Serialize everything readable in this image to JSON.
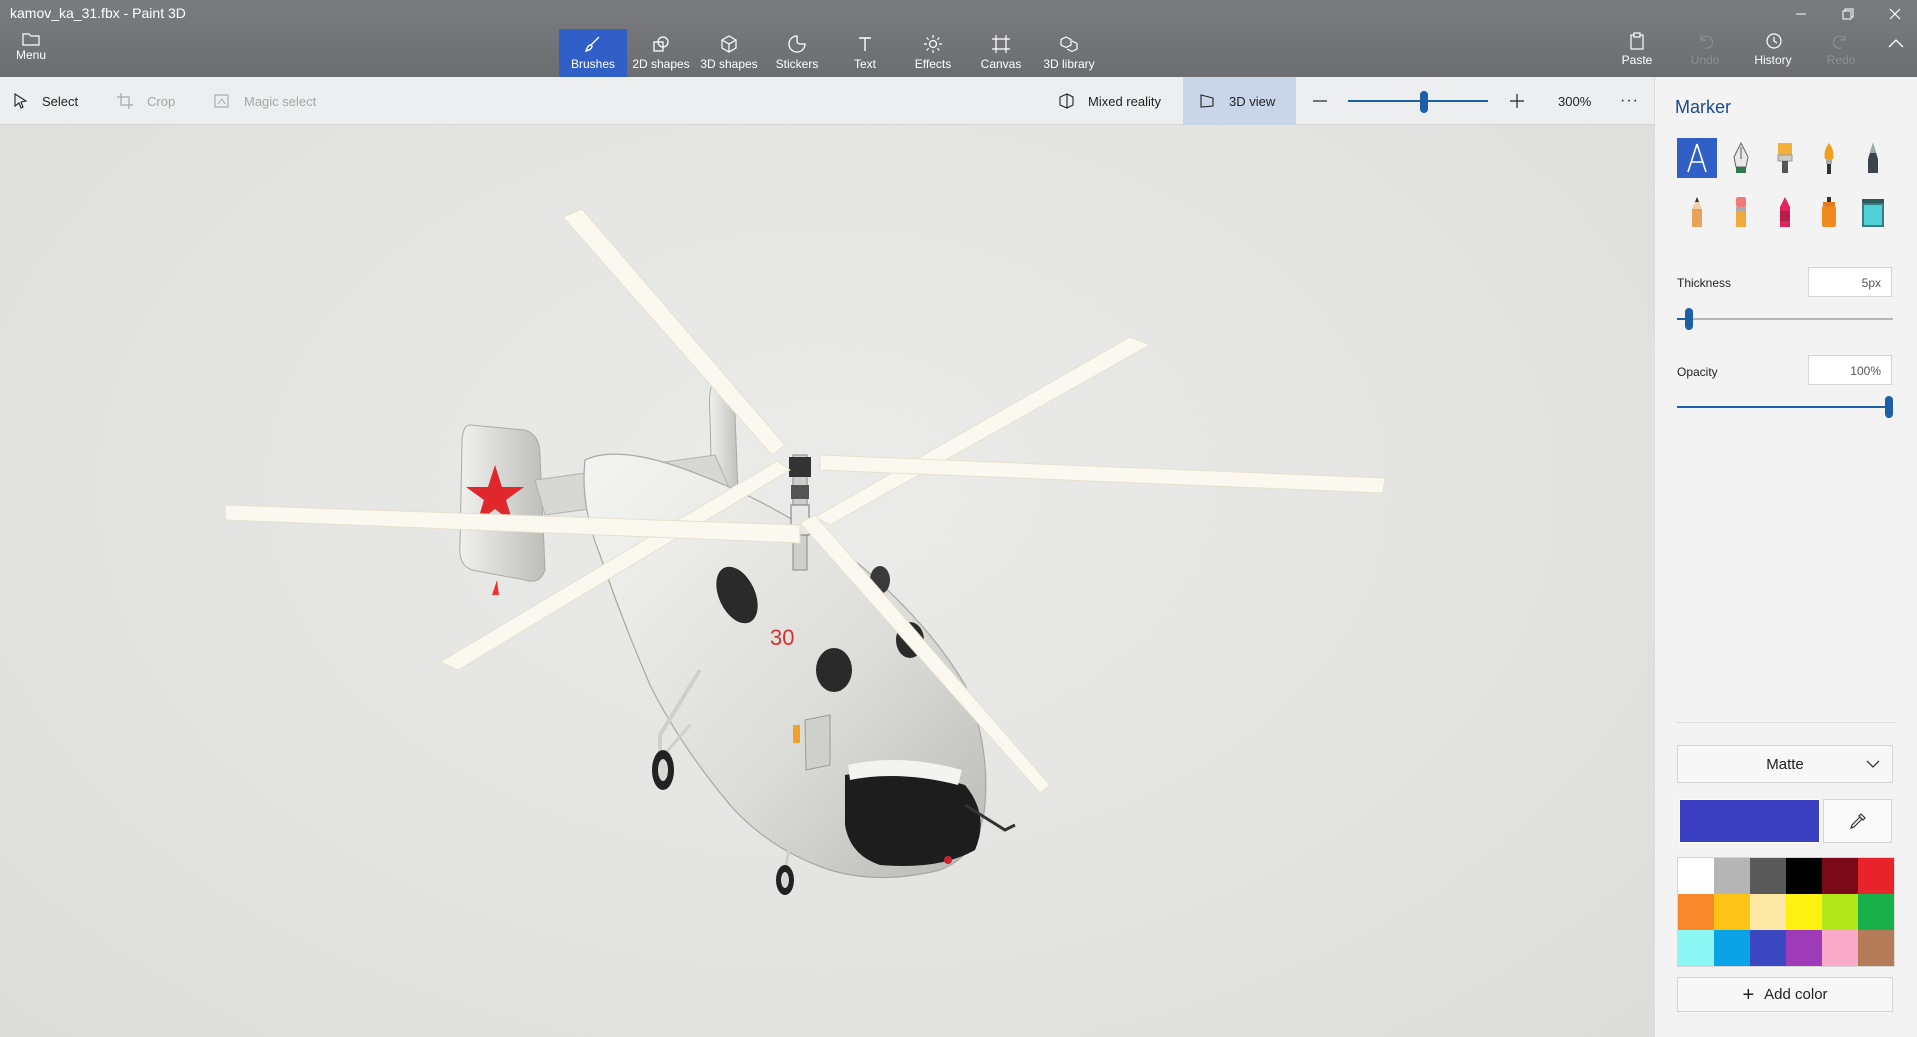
{
  "window": {
    "title": "kamov_ka_31.fbx - Paint 3D",
    "controls": [
      "minimize-icon",
      "restore-icon",
      "close-icon"
    ]
  },
  "ribbon": {
    "menu_label": "Menu",
    "tools": [
      {
        "label": "Brushes",
        "icon": "brush-icon",
        "active": true
      },
      {
        "label": "2D shapes",
        "icon": "2d-shapes-icon",
        "active": false
      },
      {
        "label": "3D shapes",
        "icon": "3d-shapes-icon",
        "active": false
      },
      {
        "label": "Stickers",
        "icon": "stickers-icon",
        "active": false
      },
      {
        "label": "Text",
        "icon": "text-icon",
        "active": false
      },
      {
        "label": "Effects",
        "icon": "effects-icon",
        "active": false
      },
      {
        "label": "Canvas",
        "icon": "canvas-icon",
        "active": false
      },
      {
        "label": "3D library",
        "icon": "3d-library-icon",
        "active": false
      }
    ],
    "right_tools": [
      {
        "label": "Paste",
        "enabled": true
      },
      {
        "label": "Undo",
        "enabled": false
      },
      {
        "label": "History",
        "enabled": true
      },
      {
        "label": "Redo",
        "enabled": false
      }
    ]
  },
  "toolbar": {
    "select": "Select",
    "crop": "Crop",
    "magic_select": "Magic select",
    "mixed_reality": "Mixed reality",
    "view_3d": "3D view",
    "zoom_percent": "300%",
    "more": "···"
  },
  "panel": {
    "title": "Marker",
    "brushes": [
      "marker-icon",
      "calligraphy-pen-icon",
      "oil-brush-icon",
      "watercolor-icon",
      "pixel-pen-icon",
      "pencil-icon",
      "eraser-icon",
      "crayon-icon",
      "spray-can-icon",
      "fill-icon"
    ],
    "thickness_label": "Thickness",
    "thickness_value": "5px",
    "thickness_fraction": 0.04,
    "opacity_label": "Opacity",
    "opacity_value": "100%",
    "opacity_fraction": 1.0,
    "finish": "Matte",
    "current_color": "#3a3ec0",
    "palette": [
      "#ffffff",
      "#b5b5b5",
      "#595959",
      "#000000",
      "#7a0a17",
      "#e8242a",
      "#f7892a",
      "#fdc316",
      "#fde8a4",
      "#fef212",
      "#b4e61c",
      "#17b04a",
      "#8cf7f5",
      "#0aa3e8",
      "#3b47c0",
      "#9e3bb8",
      "#f9aac8",
      "#b47b58"
    ],
    "add_color": "Add color"
  },
  "colors": {
    "accent": "#2f5fc7",
    "ribbon": "#6e7074",
    "slider": "#1d5ea8"
  }
}
